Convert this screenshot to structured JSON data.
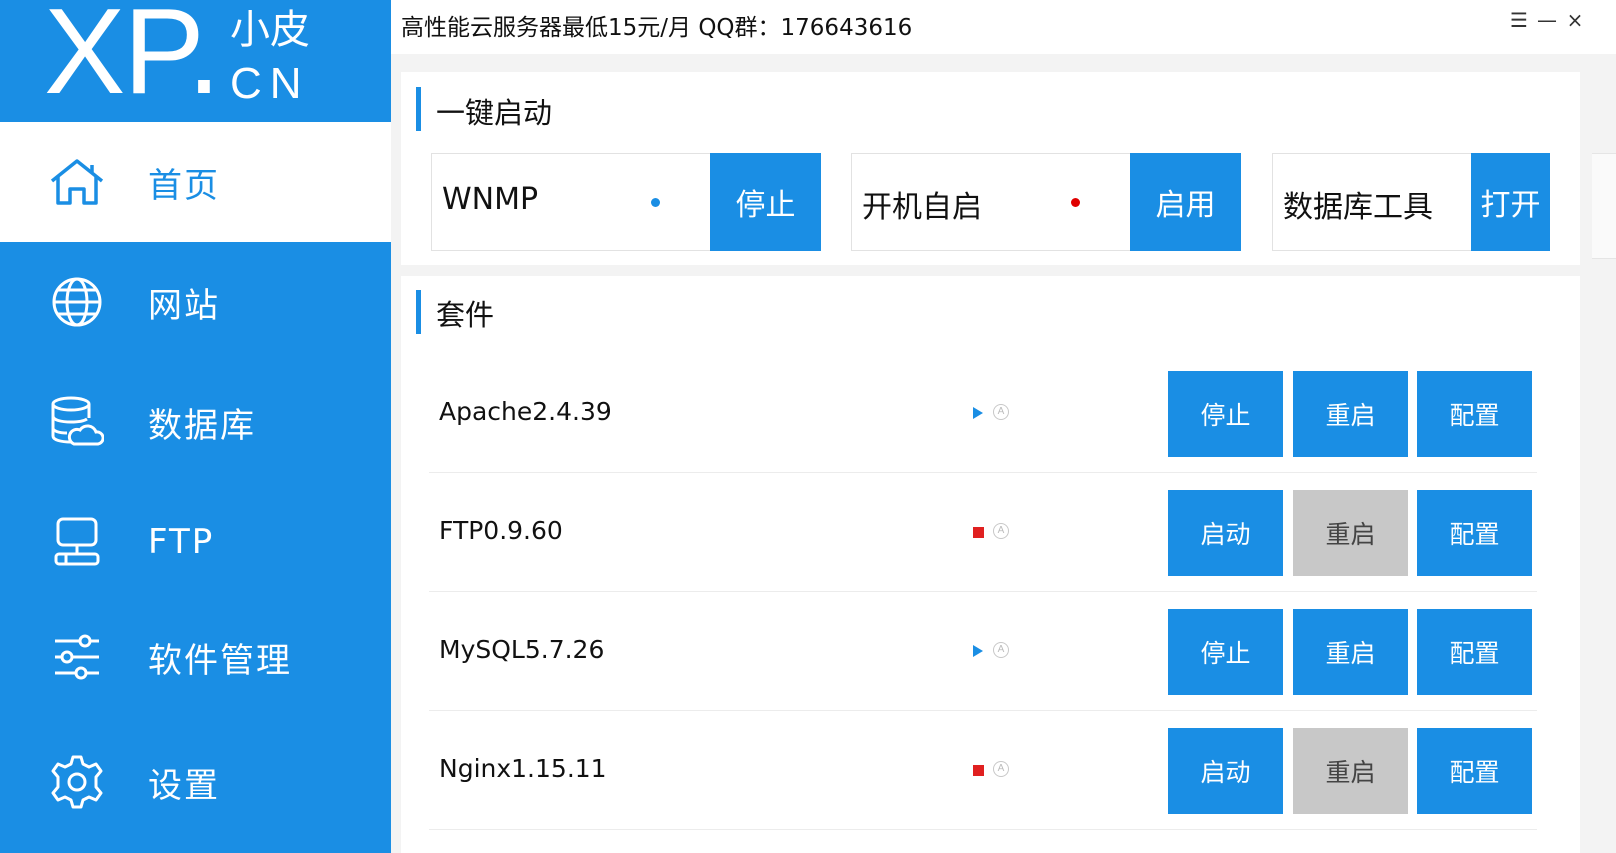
{
  "logo": {
    "xp": "XP",
    "dot": ".",
    "xiao": "小皮",
    "cn": "CN"
  },
  "sidebar": {
    "items": [
      {
        "label": "首页",
        "icon": "home-icon",
        "active": true
      },
      {
        "label": "网站",
        "icon": "globe-icon",
        "active": false
      },
      {
        "label": "数据库",
        "icon": "database-icon",
        "active": false
      },
      {
        "label": "FTP",
        "icon": "ftp-server-icon",
        "active": false
      },
      {
        "label": "软件管理",
        "icon": "sliders-icon",
        "active": false
      },
      {
        "label": "设置",
        "icon": "gear-icon",
        "active": false
      }
    ]
  },
  "topbar": {
    "notice": "高性能云服务器最低15元/月  QQ群：176643616",
    "menu_glyph": "☰",
    "min_glyph": "—",
    "close_glyph": "×"
  },
  "quickstart": {
    "title": "一键启动",
    "cards": [
      {
        "label": "WNMP",
        "button": "停止",
        "dot_color": "#1a8ee4"
      },
      {
        "label": "开机自启",
        "button": "启用",
        "dot_color": "#e00000"
      },
      {
        "label": "数据库工具",
        "button": "打开"
      }
    ]
  },
  "suite": {
    "title": "套件",
    "rows": [
      {
        "name": "Apache2.4.39",
        "status": "running",
        "auto_glyph": "A",
        "actions": [
          "停止",
          "重启",
          "配置"
        ],
        "restart_enabled": true
      },
      {
        "name": "FTP0.9.60",
        "status": "stopped",
        "auto_glyph": "A",
        "actions": [
          "启动",
          "重启",
          "配置"
        ],
        "restart_enabled": false
      },
      {
        "name": "MySQL5.7.26",
        "status": "running",
        "auto_glyph": "A",
        "actions": [
          "停止",
          "重启",
          "配置"
        ],
        "restart_enabled": true
      },
      {
        "name": "Nginx1.15.11",
        "status": "stopped",
        "auto_glyph": "A",
        "actions": [
          "启动",
          "重启",
          "配置"
        ],
        "restart_enabled": false
      }
    ]
  },
  "colors": {
    "accent": "#1a8ee4",
    "disabled": "#c8c8c8",
    "stopped": "#e02020"
  }
}
